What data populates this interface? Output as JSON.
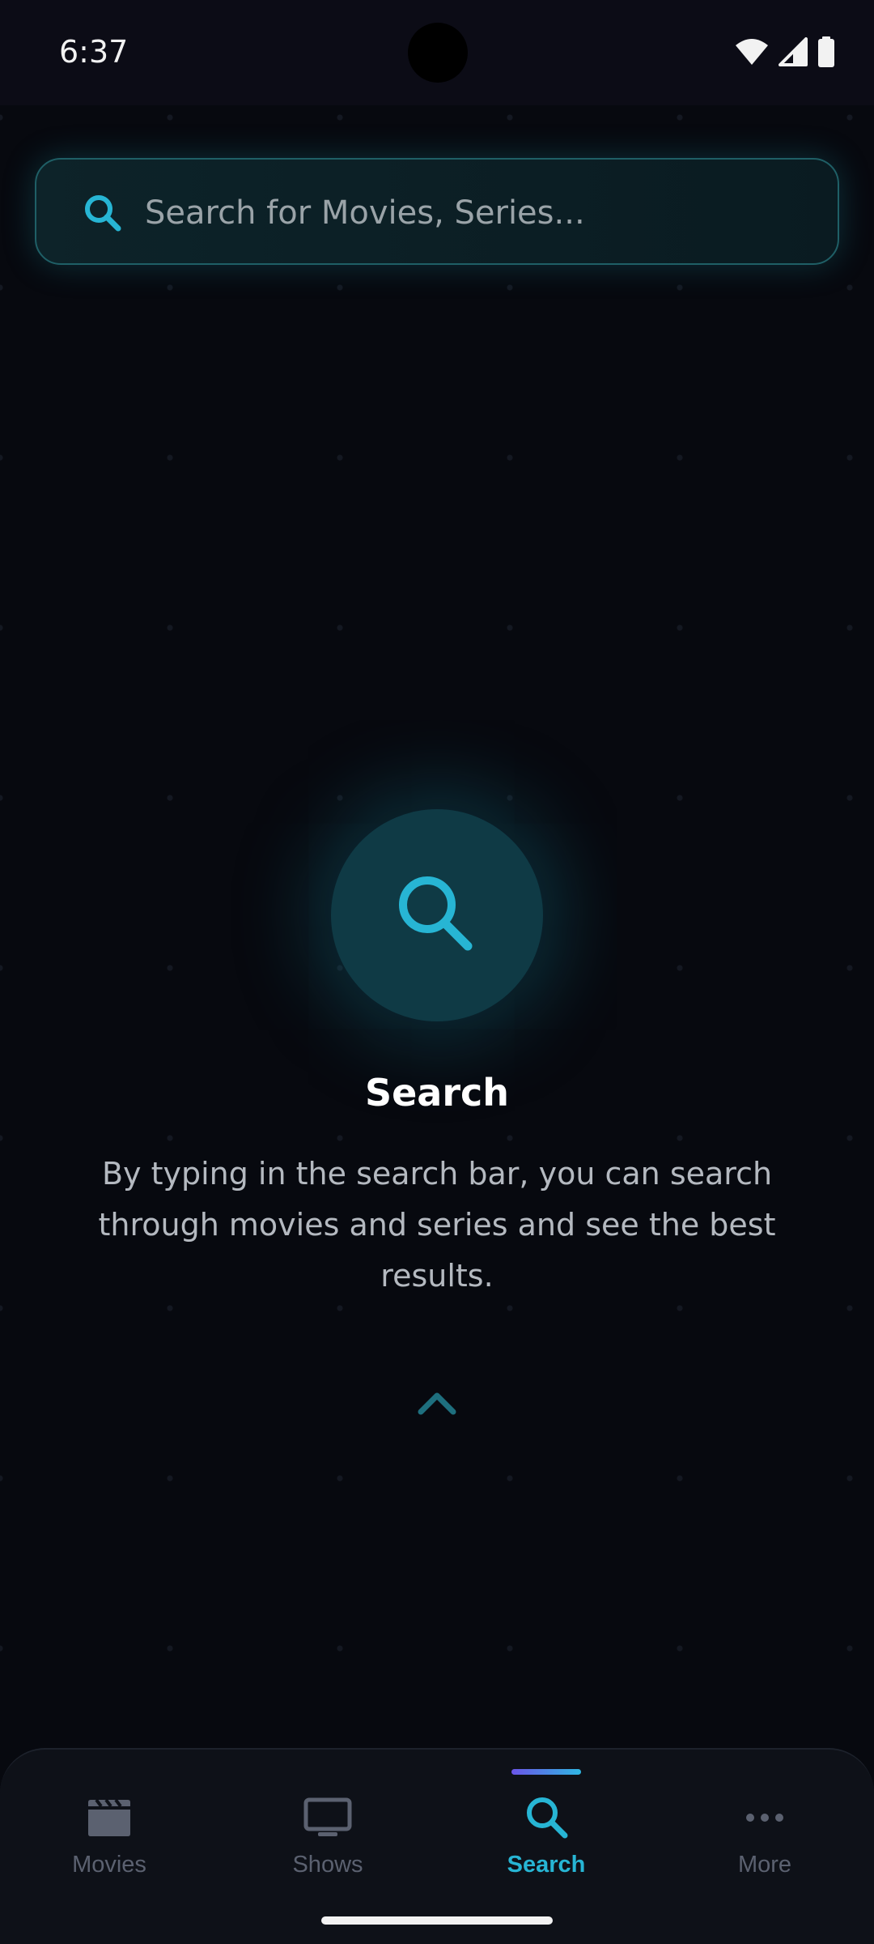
{
  "status_bar": {
    "time": "6:37",
    "icons": [
      "wifi-icon",
      "signal-icon",
      "battery-icon"
    ]
  },
  "search": {
    "placeholder": "Search for Movies, Series...",
    "value": "",
    "icon": "search-icon"
  },
  "empty_state": {
    "icon": "search-icon",
    "title": "Search",
    "description": "By typing in the search bar, you can search through movies and series and see the best results.",
    "hint_icon": "chevron-up-icon"
  },
  "bottom_nav": {
    "items": [
      {
        "label": "Movies",
        "icon": "clapperboard-icon",
        "active": false
      },
      {
        "label": "Shows",
        "icon": "tv-icon",
        "active": false
      },
      {
        "label": "Search",
        "icon": "search-icon",
        "active": true
      },
      {
        "label": "More",
        "icon": "more-dots-icon",
        "active": false
      }
    ]
  },
  "colors": {
    "background": "#07090f",
    "accent": "#27b5d4",
    "inactive": "#5b6170",
    "indicator_start": "#6b55e8",
    "indicator_end": "#2fb7e3"
  }
}
